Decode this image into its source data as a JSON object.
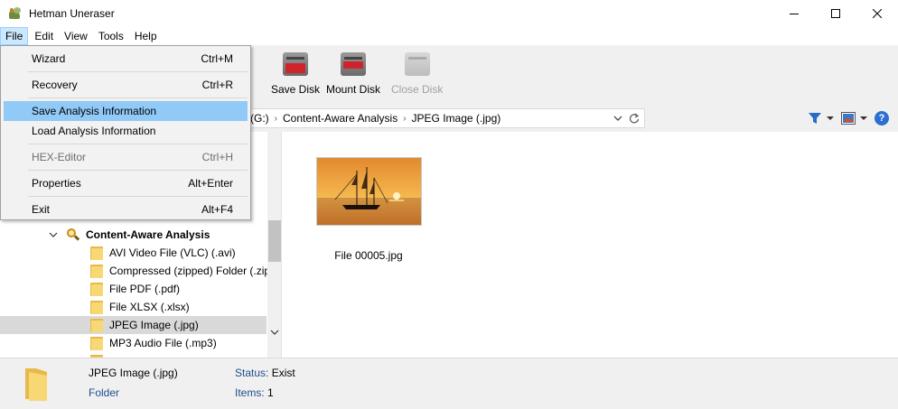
{
  "window": {
    "title": "Hetman Uneraser"
  },
  "menubar": {
    "items": [
      "File",
      "Edit",
      "View",
      "Tools",
      "Help"
    ]
  },
  "file_menu": {
    "items": [
      {
        "label": "Wizard",
        "shortcut": "Ctrl+M"
      },
      {
        "label": "Recovery",
        "shortcut": "Ctrl+R"
      },
      {
        "label": "Save Analysis Information",
        "shortcut": ""
      },
      {
        "label": "Load Analysis Information",
        "shortcut": ""
      },
      {
        "label": "HEX-Editor",
        "shortcut": "Ctrl+H"
      },
      {
        "label": "Properties",
        "shortcut": "Alt+Enter"
      },
      {
        "label": "Exit",
        "shortcut": "Alt+F4"
      }
    ]
  },
  "toolbar": {
    "save_disk": "Save Disk",
    "mount_disk": "Mount Disk",
    "close_disk": "Close Disk"
  },
  "address": {
    "crumbs": [
      "(G:)",
      "Content-Aware Analysis",
      "JPEG Image (.jpg)"
    ]
  },
  "tree": {
    "root": "Content-Aware Analysis",
    "items": [
      "AVI Video File (VLC) (.avi)",
      "Compressed (zipped) Folder (.zip)",
      "File PDF (.pdf)",
      "File XLSX (.xlsx)",
      "JPEG Image (.jpg)",
      "MP3 Audio File (.mp3)"
    ]
  },
  "content": {
    "file_name": "File 00005.jpg"
  },
  "status": {
    "name": "JPEG Image (.jpg)",
    "type": "Folder",
    "status_label": "Status:",
    "status_value": "Exist",
    "items_label": "Items:",
    "items_value": "1"
  },
  "colors": {
    "menu_highlight": "#91c9f7",
    "selected_row": "#d9d9d9",
    "accent_red": "#d0242c"
  }
}
